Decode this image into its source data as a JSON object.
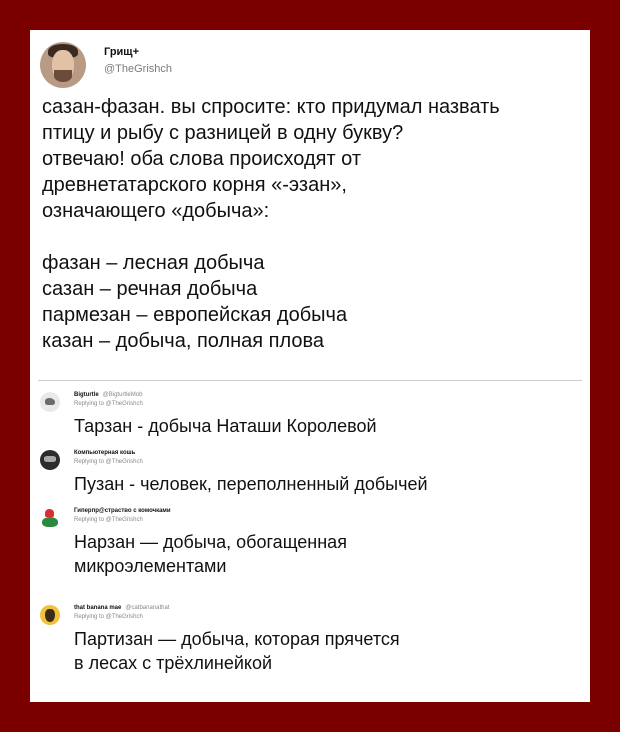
{
  "main_tweet": {
    "author_name": "Грищ+",
    "author_handle": "@TheGrishch",
    "text_lines": [
      "сазан-фазан. вы спросите: кто придумал назвать",
      "птицу и рыбу с разницей в одну букву?",
      "отвечаю! оба слова происходят от",
      "древнетатарского корня «-эзан»,",
      "означающего «добыча»:",
      "",
      "фазан – лесная добыча",
      "сазан – речная добыча",
      "пармезан – европейская добыча",
      "казан – добыча, полная плова"
    ]
  },
  "replies": [
    {
      "name": "Bigturtle",
      "handle": "@BigturtleMob",
      "meta": "Replying to @TheGrishch",
      "lines": [
        "Тарзан - добыча Наташи Королевой"
      ]
    },
    {
      "name": "Компьютерная кошь",
      "handle": "",
      "meta": "Replying to @TheGrishch",
      "lines": [
        "Пузан - человек, переполненный добычей"
      ]
    },
    {
      "name": "Гиперпр@страство с комочками",
      "handle": "",
      "meta": "Replying to @TheGrishch",
      "lines": [
        "Нарзан — добыча, обогащенная",
        "микроэлементами"
      ]
    },
    {
      "name": "that banana mae",
      "handle": "@catbananathat",
      "meta": "Replying to @TheGrishch",
      "lines": [
        "Партизан — добыча, которая прячется",
        "в лесах с трёхлинейкой"
      ]
    }
  ]
}
